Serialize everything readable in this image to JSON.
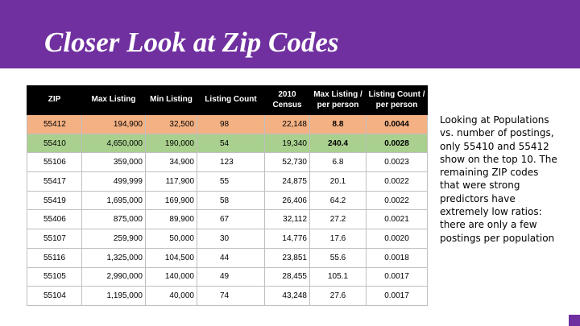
{
  "slide": {
    "title": "Closer Look at Zip Codes",
    "accent_color": "#7030a0"
  },
  "table": {
    "headers": {
      "zip": "ZIP",
      "max_listing": "Max Listing",
      "min_listing": "Min Listing",
      "listing_count": "Listing Count",
      "census_2010": "2010 Census",
      "max_per_person": "Max Listing / per person",
      "count_per_person": "Listing Count / per person"
    },
    "highlight_colors": {
      "orange": "#f4b183",
      "green": "#a9d08e"
    },
    "rows": [
      {
        "zip": "55412",
        "max_listing": "194,900",
        "min_listing": "32,500",
        "listing_count": "98",
        "census_2010": "22,148",
        "max_per_person": "8.8",
        "count_per_person": "0.0044"
      },
      {
        "zip": "55410",
        "max_listing": "4,650,000",
        "min_listing": "190,000",
        "listing_count": "54",
        "census_2010": "19,340",
        "max_per_person": "240.4",
        "count_per_person": "0.0028"
      },
      {
        "zip": "55106",
        "max_listing": "359,000",
        "min_listing": "34,900",
        "listing_count": "123",
        "census_2010": "52,730",
        "max_per_person": "6.8",
        "count_per_person": "0.0023"
      },
      {
        "zip": "55417",
        "max_listing": "499,999",
        "min_listing": "117,900",
        "listing_count": "55",
        "census_2010": "24,875",
        "max_per_person": "20.1",
        "count_per_person": "0.0022"
      },
      {
        "zip": "55419",
        "max_listing": "1,695,000",
        "min_listing": "169,900",
        "listing_count": "58",
        "census_2010": "26,406",
        "max_per_person": "64.2",
        "count_per_person": "0.0022"
      },
      {
        "zip": "55406",
        "max_listing": "875,000",
        "min_listing": "89,900",
        "listing_count": "67",
        "census_2010": "32,112",
        "max_per_person": "27.2",
        "count_per_person": "0.0021"
      },
      {
        "zip": "55107",
        "max_listing": "259,900",
        "min_listing": "50,000",
        "listing_count": "30",
        "census_2010": "14,776",
        "max_per_person": "17.6",
        "count_per_person": "0.0020"
      },
      {
        "zip": "55116",
        "max_listing": "1,325,000",
        "min_listing": "104,500",
        "listing_count": "44",
        "census_2010": "23,851",
        "max_per_person": "55.6",
        "count_per_person": "0.0018"
      },
      {
        "zip": "55105",
        "max_listing": "2,990,000",
        "min_listing": "140,000",
        "listing_count": "49",
        "census_2010": "28,455",
        "max_per_person": "105.1",
        "count_per_person": "0.0017"
      },
      {
        "zip": "55104",
        "max_listing": "1,195,000",
        "min_listing": "40,000",
        "listing_count": "74",
        "census_2010": "43,248",
        "max_per_person": "27.6",
        "count_per_person": "0.0017"
      }
    ]
  },
  "side_note": {
    "text": "Looking at Populations vs. number of postings, only 55410 and 55412 show on the top 10. The remaining ZIP codes that were strong predictors have extremely low ratios: there are only a few postings per population"
  }
}
